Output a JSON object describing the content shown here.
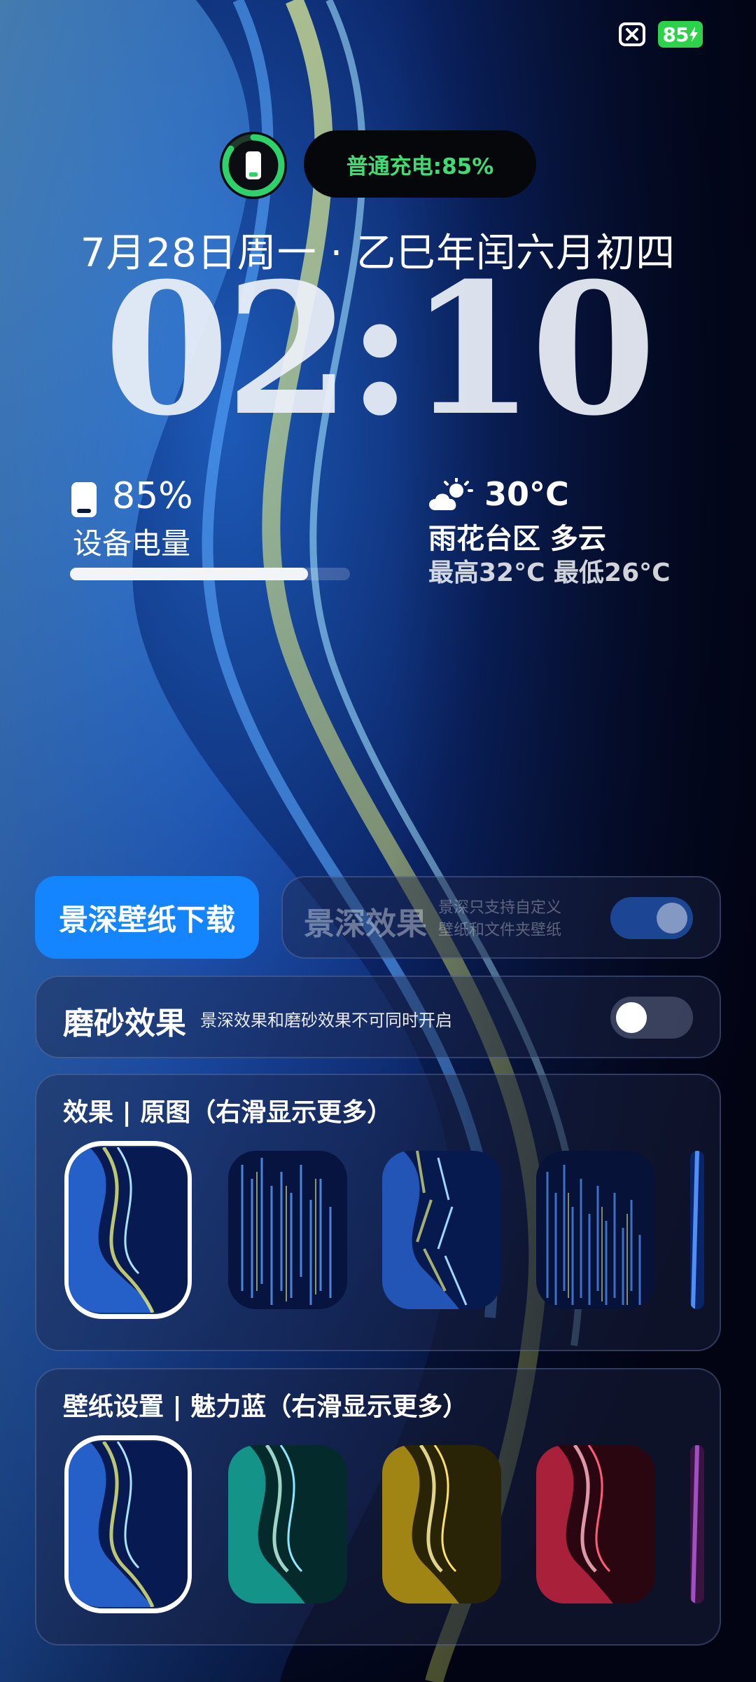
{
  "status_bar": {
    "battery_level": "85",
    "close_icon": "close-box-icon",
    "charging_icon": "bolt-icon"
  },
  "charging": {
    "label": "普通充电:85%",
    "ring_color": "#2fd26a",
    "level_fraction": 0.85
  },
  "lock_screen": {
    "date": "7月28日周一 · 乙巳年闰六月初四",
    "time": "02:10"
  },
  "device_battery": {
    "percent": "85%",
    "label": "设备电量",
    "level_fraction": 0.85,
    "icon": "phone-battery-icon"
  },
  "weather": {
    "temperature": "30°C",
    "location_condition": "雨花台区 多云",
    "range": "最高32°C 最低26°C",
    "icon": "partly-cloudy-icon"
  },
  "controls": {
    "download_label": "景深壁纸下载",
    "depth_title": "景深效果",
    "depth_sub_line1": "景深只支持自定义",
    "depth_sub_line2": "壁纸和文件夹壁纸",
    "depth_toggle_on": true,
    "frost_title": "磨砂效果",
    "frost_sub": "景深效果和磨砂效果不可同时开启",
    "frost_toggle_on": false
  },
  "effects_panel": {
    "title": "效果 | 原图（右滑显示更多）",
    "selected_index": 0
  },
  "wallpaper_panel": {
    "title": "壁纸设置 | 魅力蓝（右滑显示更多）",
    "selected_index": 0
  },
  "colors": {
    "accent_blue": "#1585ff",
    "charge_green": "#3fdc73"
  }
}
